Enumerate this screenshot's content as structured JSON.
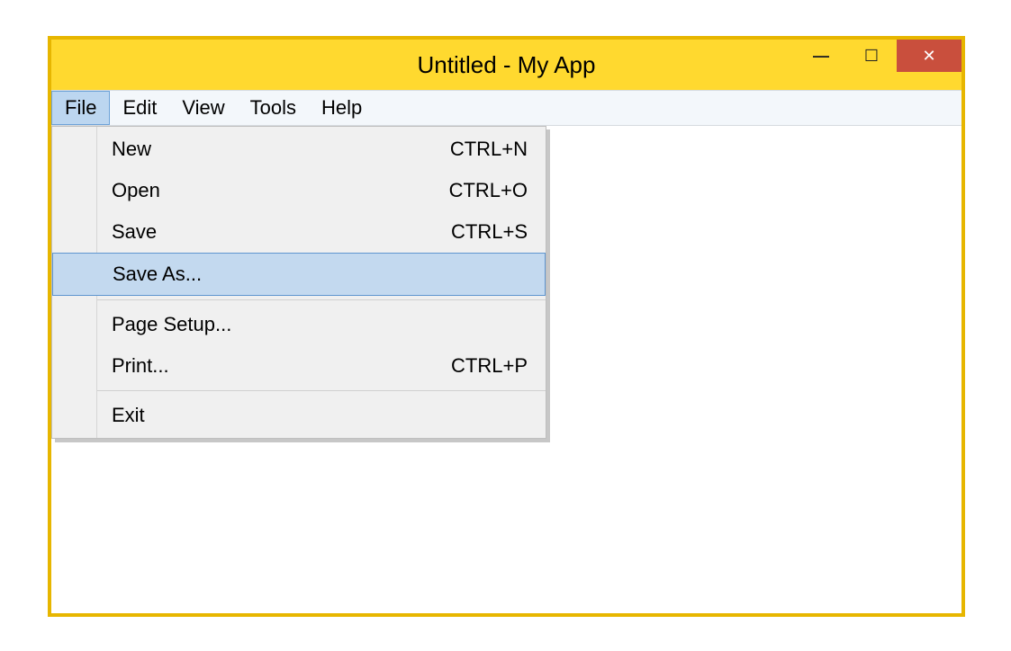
{
  "window": {
    "title": "Untitled - My App",
    "controls": {
      "minimize_glyph": "—",
      "maximize_glyph": "☐",
      "close_glyph": "✕"
    }
  },
  "menubar": {
    "items": [
      {
        "label": "File",
        "active": true
      },
      {
        "label": "Edit"
      },
      {
        "label": "View"
      },
      {
        "label": "Tools"
      },
      {
        "label": "Help"
      }
    ]
  },
  "file_menu": {
    "items": [
      {
        "label": "New",
        "shortcut": "CTRL+N"
      },
      {
        "label": "Open",
        "shortcut": "CTRL+O"
      },
      {
        "label": "Save",
        "shortcut": "CTRL+S"
      },
      {
        "label": "Save As...",
        "shortcut": "",
        "highlighted": true
      },
      {
        "separator": true
      },
      {
        "label": "Page Setup...",
        "shortcut": ""
      },
      {
        "label": "Print...",
        "shortcut": "CTRL+P"
      },
      {
        "separator": true
      },
      {
        "label": "Exit",
        "shortcut": ""
      }
    ]
  }
}
